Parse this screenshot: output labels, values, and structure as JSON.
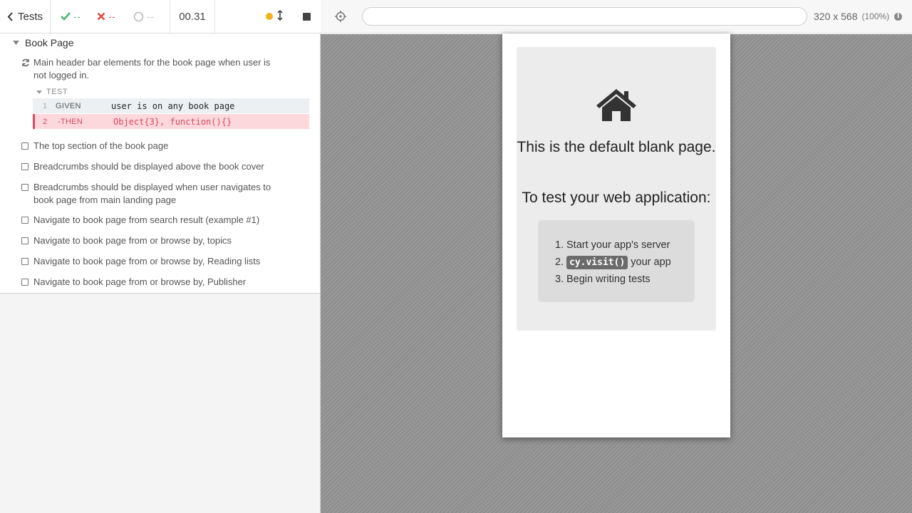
{
  "reporter": {
    "back_label": "Tests",
    "stats": {
      "passed": "--",
      "failed": "--",
      "pending": "--"
    },
    "duration": "00.31",
    "colors": {
      "passed": "#4fb37c",
      "failed": "#e04a4a",
      "running_dot": "#f1b21a",
      "error_bg": "#fcd8dd"
    }
  },
  "suite": {
    "title": "Book Page",
    "running_test": "Main header bar elements for the book page when user is not logged in.",
    "command_header": "TEST",
    "commands": [
      {
        "num": "1",
        "keyword": "GIVEN",
        "arg": "user is on any book page"
      },
      {
        "num": "2",
        "keyword": "-THEN",
        "arg": "Object{3}, function(){}"
      }
    ],
    "tests": [
      "The top section of the book page",
      "Breadcrumbs should be displayed above the book cover",
      "Breadcrumbs should be displayed when user navigates to book page from main landing page",
      "Navigate to book page from search result (example #1)",
      "Navigate to book page from or browse by, topics",
      "Navigate to book page from or browse by, Reading lists",
      "Navigate to book page from or browse by, Publisher"
    ]
  },
  "aut": {
    "url": "",
    "viewport": "320 x 568",
    "zoom": "(100%)",
    "info_glyph": "i"
  },
  "blank_page": {
    "heading": "This is the default blank page.",
    "subheading": "To test your web application:",
    "steps": [
      {
        "n": "1.",
        "text": "Start your app's server"
      },
      {
        "n": "2.",
        "code": "cy.visit()",
        "text": "your app"
      },
      {
        "n": "3.",
        "text": "Begin writing tests"
      }
    ]
  }
}
